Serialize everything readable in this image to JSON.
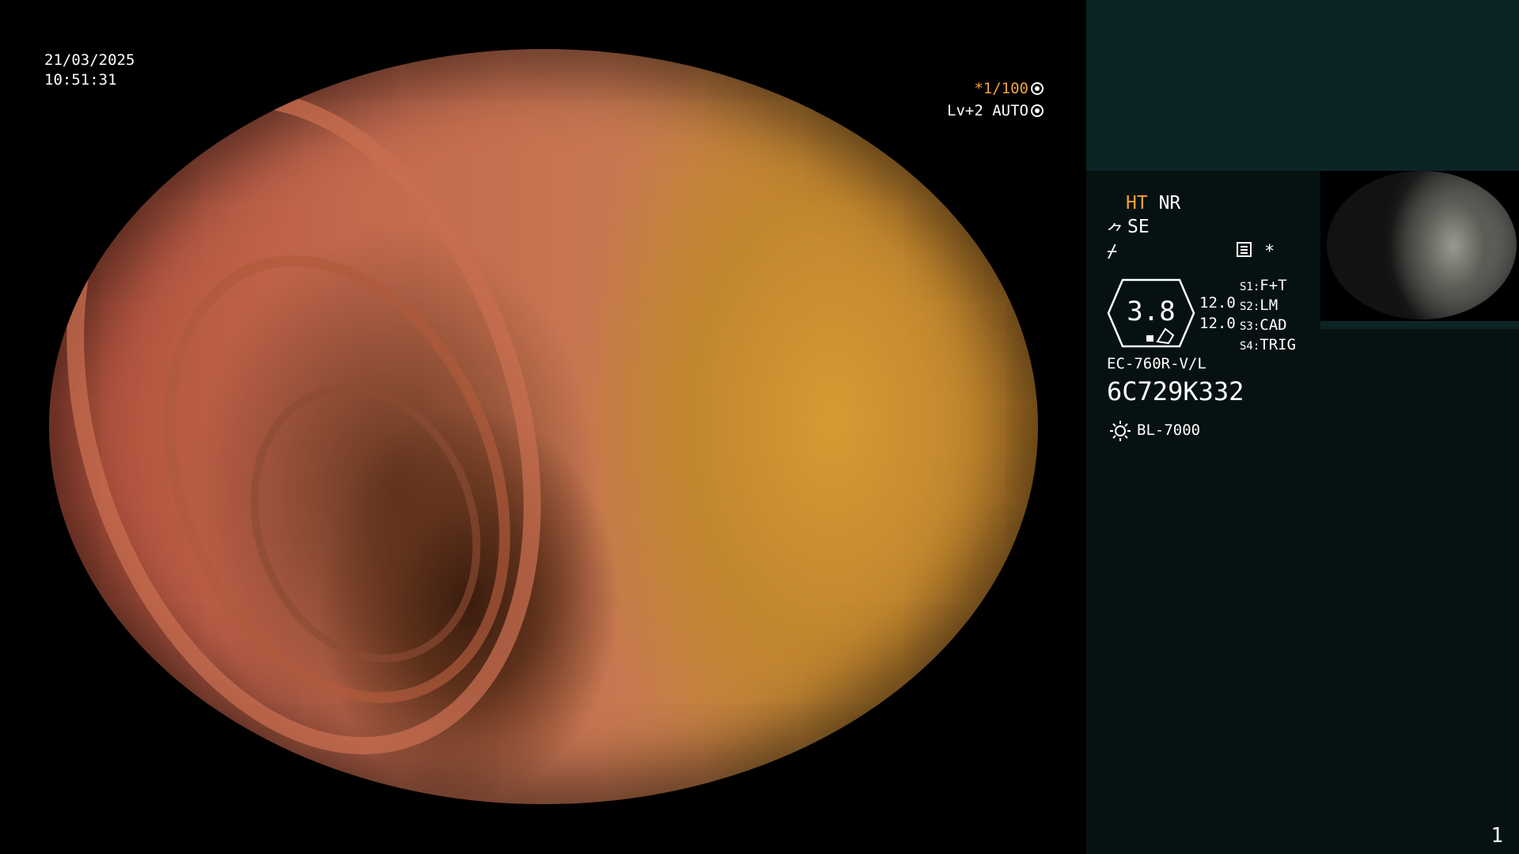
{
  "overlay": {
    "date": "21/03/2025",
    "time": "10:51:31",
    "shutter": "*1/100",
    "iris": "Lv+2 AUTO"
  },
  "panel": {
    "mode1": "HT",
    "mode2": "NR",
    "mode3": "SE",
    "zoom_value": "3.8",
    "value_a": "12.0",
    "value_b": "12.0",
    "switches": [
      {
        "key": "S1:",
        "label": "F+T"
      },
      {
        "key": "S2:",
        "label": "LM"
      },
      {
        "key": "S3:",
        "label": "CAD"
      },
      {
        "key": "S4:",
        "label": "TRIG"
      }
    ],
    "scope_model": "EC-760R-V/L",
    "scope_serial": "6C729K332",
    "light_source": "BL-7000",
    "page_number": "1"
  },
  "colors": {
    "accent_orange": "#f3a23c",
    "panel_bg": "#061212",
    "panel_top_bg": "#0c2426"
  },
  "icons": [
    "wheel-icon",
    "iris-icon",
    "tweezers-icon",
    "slash-icon",
    "memo-icon",
    "star-icon",
    "hexagon-badge-icon",
    "sun-icon"
  ]
}
